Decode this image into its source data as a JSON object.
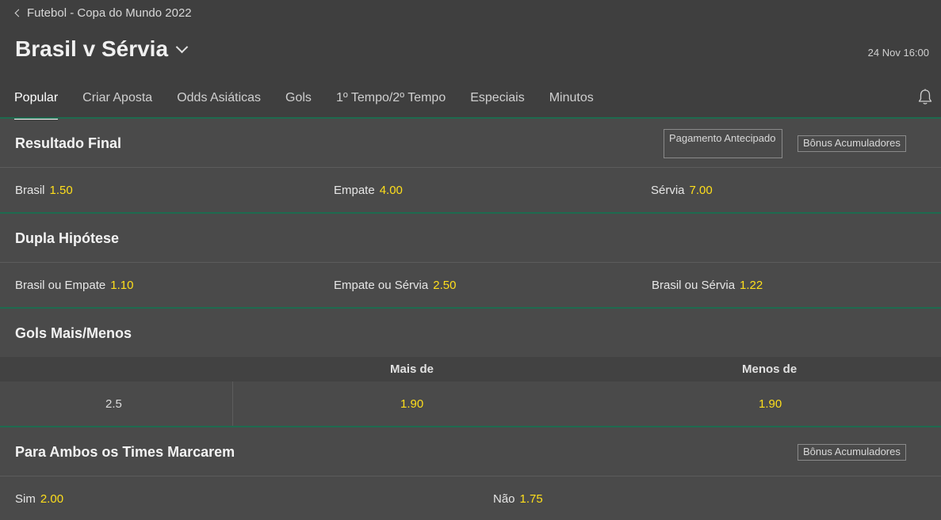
{
  "breadcrumb": "Futebol - Copa do Mundo 2022",
  "match": {
    "title": "Brasil v Sérvia",
    "date": "24 Nov 16:00"
  },
  "tabs": [
    {
      "label": "Popular",
      "active": true
    },
    {
      "label": "Criar Aposta"
    },
    {
      "label": "Odds Asiáticas"
    },
    {
      "label": "Gols"
    },
    {
      "label": "1º Tempo/2º Tempo"
    },
    {
      "label": "Especiais"
    },
    {
      "label": "Minutos"
    }
  ],
  "icons": {
    "back": "chevron-left-icon",
    "dropdown": "chevron-down-icon",
    "bell": "bell-icon"
  },
  "colors": {
    "odds": "#ffdf1b",
    "accent_line": "#1e6b4f",
    "background": "#4a4a4a",
    "header": "#3f3f3f"
  },
  "markets": {
    "resultado_final": {
      "title": "Resultado Final",
      "early_payout": "Pagamento Antecipado",
      "bonus": "Bônus Acumuladores",
      "outcomes": [
        {
          "label": "Brasil",
          "odd": "1.50"
        },
        {
          "label": "Empate",
          "odd": "4.00"
        },
        {
          "label": "Sérvia",
          "odd": "7.00"
        }
      ]
    },
    "dupla_hipotese": {
      "title": "Dupla Hipótese",
      "outcomes": [
        {
          "label": "Brasil ou Empate",
          "odd": "1.10"
        },
        {
          "label": "Empate ou Sérvia",
          "odd": "2.50"
        },
        {
          "label": "Brasil ou Sérvia",
          "odd": "1.22"
        }
      ]
    },
    "gols": {
      "title": "Gols Mais/Menos",
      "col_over": "Mais de",
      "col_under": "Menos de",
      "rows": [
        {
          "line": "2.5",
          "over": "1.90",
          "under": "1.90"
        }
      ]
    },
    "ambos_marcam": {
      "title": "Para Ambos os Times Marcarem",
      "bonus": "Bônus Acumuladores",
      "outcomes": [
        {
          "label": "Sim",
          "odd": "2.00"
        },
        {
          "label": "Não",
          "odd": "1.75"
        }
      ]
    }
  }
}
